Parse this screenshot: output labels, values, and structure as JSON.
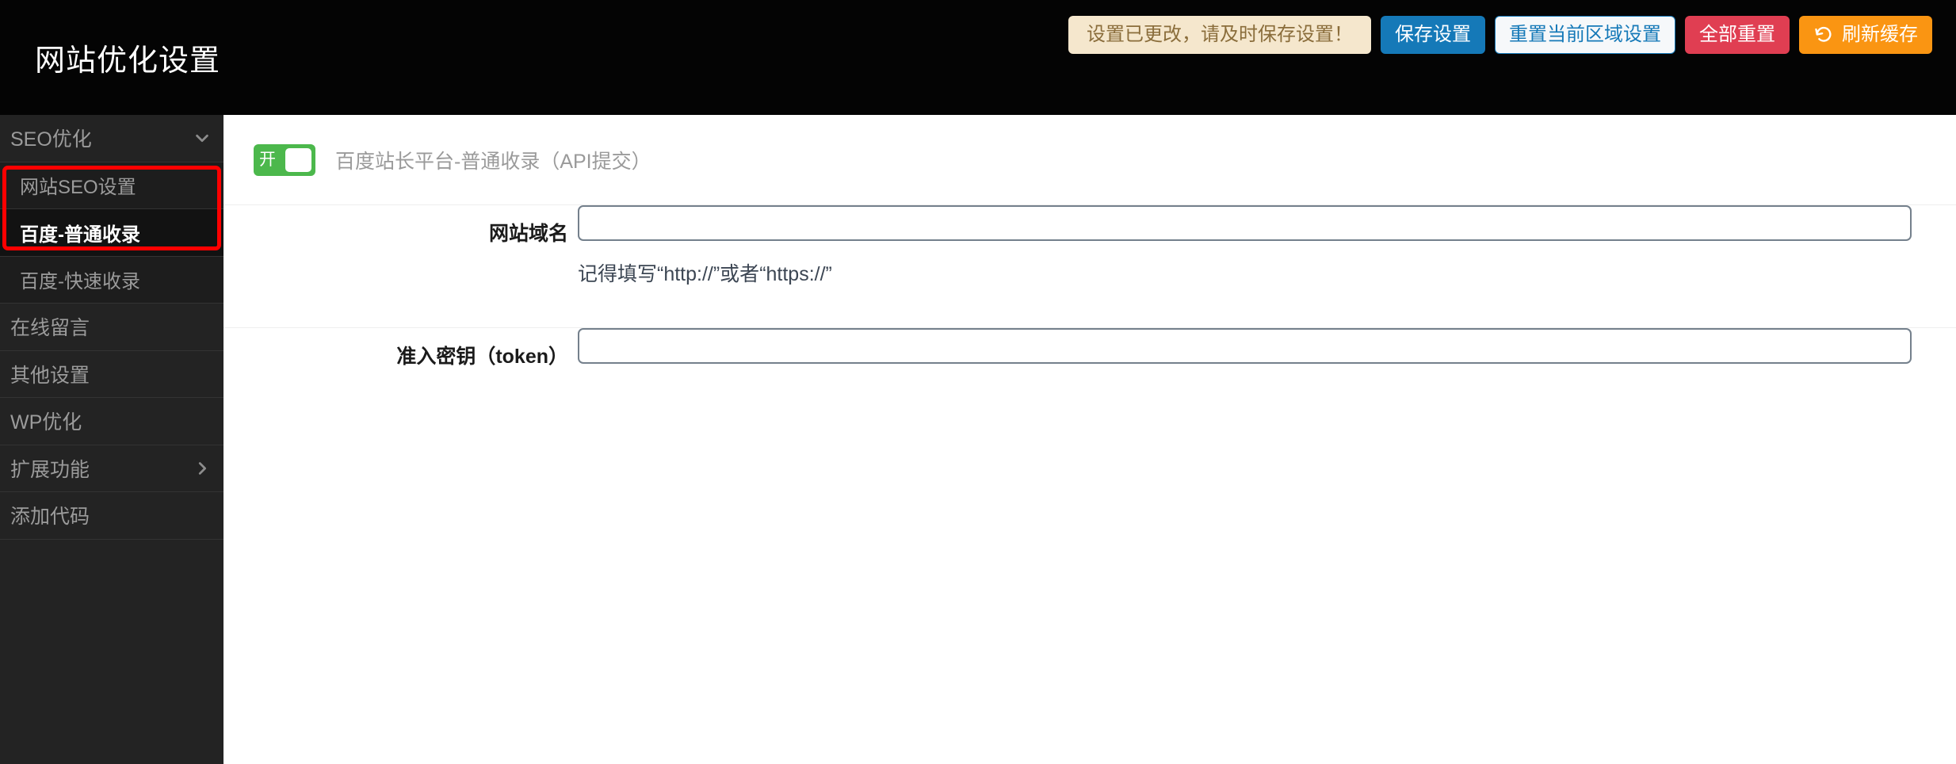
{
  "header": {
    "title": "网站优化设置",
    "alert": "设置已更改，请及时保存设置！",
    "buttons": [
      {
        "label": "保存设置",
        "style": "primary"
      },
      {
        "label": "重置当前区域设置",
        "style": "light"
      },
      {
        "label": "全部重置",
        "style": "danger"
      },
      {
        "label": "刷新缓存",
        "style": "warn",
        "icon": "refresh-icon"
      }
    ],
    "colors": {
      "bar_background": "#040404",
      "alert_background": "#f5e7cd",
      "alert_text": "#8a6d3b",
      "primary": "#1579b8",
      "danger": "#e03e52",
      "warn": "#fa9512"
    }
  },
  "sidebar": {
    "items": [
      {
        "label": "SEO优化",
        "type": "group",
        "icon": "chevron-down-icon",
        "active": false
      },
      {
        "label": "网站SEO设置",
        "type": "child",
        "icon": "",
        "active": false
      },
      {
        "label": "百度-普通收录",
        "type": "child",
        "icon": "",
        "active": true
      },
      {
        "label": "百度-快速收录",
        "type": "child",
        "icon": "",
        "active": false
      },
      {
        "label": "在线留言",
        "type": "group",
        "icon": "",
        "active": false
      },
      {
        "label": "其他设置",
        "type": "group",
        "icon": "",
        "active": false
      },
      {
        "label": "WP优化",
        "type": "group",
        "icon": "",
        "active": false
      },
      {
        "label": "扩展功能",
        "type": "group",
        "icon": "chevron-right-icon",
        "active": false
      },
      {
        "label": "添加代码",
        "type": "group",
        "icon": "",
        "active": false
      }
    ],
    "annotation": {
      "color": "#ff0000",
      "surrounds": [
        "百度-普通收录",
        "百度-快速收录"
      ]
    }
  },
  "main": {
    "feature_toggle": {
      "state_label": "开",
      "enabled": true,
      "color": "#4cb84c",
      "description": "百度站长平台-普通收录（API提交）"
    },
    "fields": [
      {
        "label": "网站域名",
        "value": "",
        "placeholder": "",
        "hint": "记得填写“http://”或者“https://”"
      },
      {
        "label": "准入密钥（token）",
        "value": "",
        "placeholder": "",
        "hint": ""
      }
    ]
  }
}
